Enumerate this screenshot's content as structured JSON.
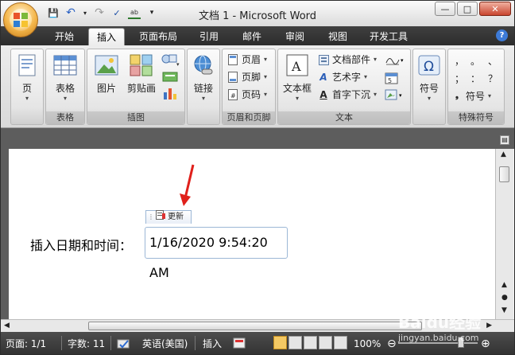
{
  "window": {
    "title": "文档 1 - Microsoft Word",
    "buttons": {
      "minimize": "—",
      "maximize": "□",
      "close": "✕"
    }
  },
  "quick_access": {
    "save": "💾",
    "undo": "↶",
    "redo": "↷",
    "more": "▾"
  },
  "tabs": [
    {
      "label": "开始"
    },
    {
      "label": "插入"
    },
    {
      "label": "页面布局"
    },
    {
      "label": "引用"
    },
    {
      "label": "邮件"
    },
    {
      "label": "审阅"
    },
    {
      "label": "视图"
    },
    {
      "label": "开发工具"
    }
  ],
  "help_label": "?",
  "ribbon": {
    "pages_group": {
      "button": "页"
    },
    "table_group": {
      "button": "表格",
      "label": "表格"
    },
    "illustrations_group": {
      "label": "插图",
      "picture": "图片",
      "clipart": "剪贴画"
    },
    "links_group": {
      "button": "链接"
    },
    "header_footer_group": {
      "label": "页眉和页脚",
      "header": "页眉",
      "footer": "页脚",
      "page_number": "页码"
    },
    "text_group": {
      "label": "文本",
      "textbox": "文本框",
      "quickparts": "文档部件",
      "wordart": "艺术字",
      "dropcap": "首字下沉"
    },
    "symbols_group": {
      "button": "符号"
    },
    "special_group": {
      "label": "特殊符号",
      "symbol": "符号",
      "chars": [
        "，",
        "。",
        "、",
        "；",
        "：",
        "？"
      ]
    }
  },
  "document": {
    "label_text": "插入日期和时间：",
    "date_value": "1/16/2020 9:54:20 AM",
    "update_button": "更新"
  },
  "statusbar": {
    "page": "页面: 1/1",
    "words": "字数: 11",
    "language": "英语(美国)",
    "mode": "插入",
    "zoom": "100%"
  },
  "watermark": {
    "title": "Baidu经验",
    "url": "jingyan.baidu.com"
  }
}
